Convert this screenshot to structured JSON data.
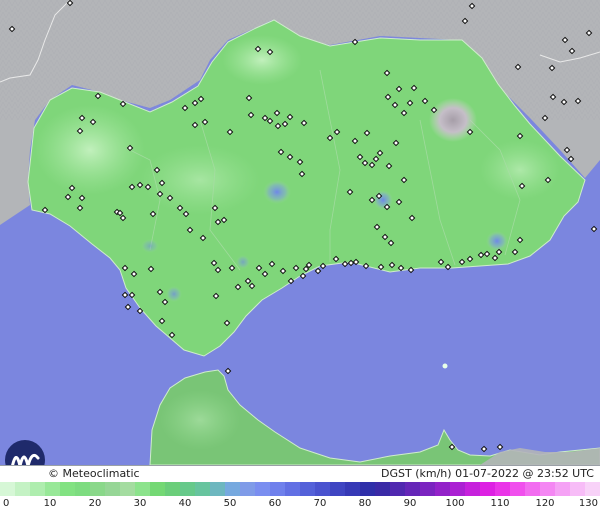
{
  "caption": {
    "brand": "© Meteoclimatic",
    "product": "DGST (km/h)   01-07-2022 @ 23:52 UTC"
  },
  "legend": {
    "ticks": [
      "0",
      "10",
      "20",
      "30",
      "40",
      "50",
      "60",
      "70",
      "80",
      "90",
      "100",
      "110",
      "120",
      "130"
    ],
    "colors": [
      "#d6f7d6",
      "#c4f2c4",
      "#aeedae",
      "#98e898",
      "#82e282",
      "#7ddc80",
      "#8ad88a",
      "#96d696",
      "#a4dca0",
      "#8ce38c",
      "#74d874",
      "#6bce7a",
      "#66c98a",
      "#67c49e",
      "#6db7bf",
      "#76a9df",
      "#7f9be8",
      "#7a8ef0",
      "#6f80ec",
      "#6270e4",
      "#5461d9",
      "#4a53cf",
      "#3f45c2",
      "#3639b6",
      "#2f2fa9",
      "#3a2aa6",
      "#5028b0",
      "#6526b8",
      "#7b24c0",
      "#9322c9",
      "#ab21d3",
      "#c621dc",
      "#dd21e3",
      "#ea35e8",
      "#f04fed",
      "#f26cf0",
      "#f487f3",
      "#f5a2f5",
      "#f7bcf7",
      "#f8d2f8"
    ]
  },
  "map": {
    "sea_color": "#7b86df",
    "land_color": "#7fd77a",
    "neighbor_land_color": "#b4b6b9",
    "mountain_color": "#c9c3cc",
    "station_marker": "diamond",
    "stations": [
      [
        70,
        3
      ],
      [
        12,
        29
      ],
      [
        258,
        49
      ],
      [
        270,
        52
      ],
      [
        355,
        42
      ],
      [
        472,
        6
      ],
      [
        465,
        21
      ],
      [
        565,
        40
      ],
      [
        572,
        51
      ],
      [
        589,
        33
      ],
      [
        518,
        67
      ],
      [
        552,
        68
      ],
      [
        553,
        97
      ],
      [
        545,
        118
      ],
      [
        564,
        102
      ],
      [
        578,
        101
      ],
      [
        520,
        136
      ],
      [
        567,
        150
      ],
      [
        571,
        159
      ],
      [
        522,
        186
      ],
      [
        548,
        180
      ],
      [
        594,
        229
      ],
      [
        98,
        96
      ],
      [
        82,
        118
      ],
      [
        93,
        122
      ],
      [
        80,
        131
      ],
      [
        123,
        104
      ],
      [
        185,
        108
      ],
      [
        195,
        103
      ],
      [
        201,
        99
      ],
      [
        195,
        125
      ],
      [
        205,
        122
      ],
      [
        230,
        132
      ],
      [
        249,
        98
      ],
      [
        251,
        115
      ],
      [
        265,
        118
      ],
      [
        270,
        121
      ],
      [
        277,
        113
      ],
      [
        278,
        126
      ],
      [
        285,
        124
      ],
      [
        290,
        117
      ],
      [
        304,
        123
      ],
      [
        330,
        138
      ],
      [
        337,
        132
      ],
      [
        355,
        141
      ],
      [
        367,
        133
      ],
      [
        387,
        73
      ],
      [
        388,
        97
      ],
      [
        395,
        105
      ],
      [
        399,
        89
      ],
      [
        404,
        113
      ],
      [
        410,
        103
      ],
      [
        414,
        88
      ],
      [
        425,
        101
      ],
      [
        434,
        110
      ],
      [
        470,
        132
      ],
      [
        130,
        148
      ],
      [
        157,
        170
      ],
      [
        148,
        187
      ],
      [
        140,
        185
      ],
      [
        132,
        187
      ],
      [
        162,
        183
      ],
      [
        160,
        194
      ],
      [
        170,
        198
      ],
      [
        180,
        208
      ],
      [
        186,
        214
      ],
      [
        72,
        188
      ],
      [
        68,
        197
      ],
      [
        82,
        198
      ],
      [
        80,
        208
      ],
      [
        45,
        210
      ],
      [
        117,
        212
      ],
      [
        120,
        213
      ],
      [
        123,
        218
      ],
      [
        153,
        214
      ],
      [
        215,
        208
      ],
      [
        218,
        222
      ],
      [
        190,
        230
      ],
      [
        203,
        238
      ],
      [
        224,
        220
      ],
      [
        281,
        152
      ],
      [
        290,
        157
      ],
      [
        300,
        162
      ],
      [
        302,
        174
      ],
      [
        360,
        157
      ],
      [
        365,
        163
      ],
      [
        372,
        165
      ],
      [
        376,
        159
      ],
      [
        380,
        153
      ],
      [
        389,
        166
      ],
      [
        396,
        143
      ],
      [
        404,
        180
      ],
      [
        350,
        192
      ],
      [
        372,
        200
      ],
      [
        387,
        207
      ],
      [
        399,
        202
      ],
      [
        412,
        218
      ],
      [
        377,
        227
      ],
      [
        385,
        237
      ],
      [
        391,
        243
      ],
      [
        379,
        196
      ],
      [
        125,
        268
      ],
      [
        134,
        274
      ],
      [
        151,
        269
      ],
      [
        125,
        295
      ],
      [
        132,
        295
      ],
      [
        128,
        307
      ],
      [
        160,
        292
      ],
      [
        165,
        302
      ],
      [
        140,
        311
      ],
      [
        162,
        321
      ],
      [
        172,
        335
      ],
      [
        214,
        263
      ],
      [
        218,
        270
      ],
      [
        232,
        268
      ],
      [
        238,
        287
      ],
      [
        216,
        296
      ],
      [
        227,
        323
      ],
      [
        248,
        281
      ],
      [
        252,
        286
      ],
      [
        259,
        268
      ],
      [
        265,
        274
      ],
      [
        272,
        264
      ],
      [
        283,
        271
      ],
      [
        291,
        281
      ],
      [
        296,
        268
      ],
      [
        303,
        276
      ],
      [
        306,
        269
      ],
      [
        309,
        265
      ],
      [
        318,
        271
      ],
      [
        323,
        266
      ],
      [
        336,
        259
      ],
      [
        345,
        264
      ],
      [
        351,
        263
      ],
      [
        356,
        262
      ],
      [
        366,
        266
      ],
      [
        381,
        267
      ],
      [
        392,
        265
      ],
      [
        401,
        268
      ],
      [
        411,
        270
      ],
      [
        441,
        262
      ],
      [
        448,
        267
      ],
      [
        462,
        262
      ],
      [
        470,
        259
      ],
      [
        481,
        255
      ],
      [
        487,
        254
      ],
      [
        495,
        258
      ],
      [
        499,
        252
      ],
      [
        515,
        252
      ],
      [
        520,
        240
      ],
      [
        228,
        371
      ],
      [
        452,
        447
      ],
      [
        484,
        449
      ],
      [
        500,
        447
      ]
    ]
  }
}
